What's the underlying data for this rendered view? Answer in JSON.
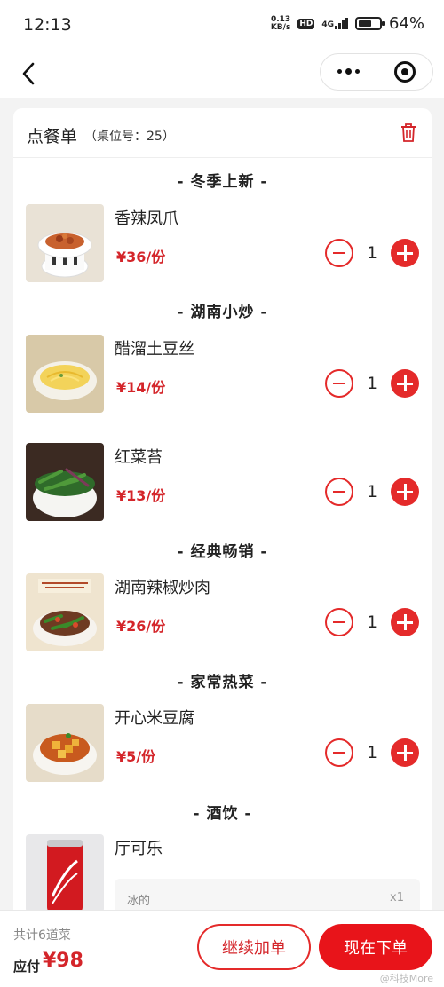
{
  "status": {
    "time": "12:13",
    "net_speed_top": "0.13",
    "net_speed_bottom": "KB/s",
    "hd": "HD",
    "network": "4G",
    "battery": "64%",
    "battery_level": 0.64
  },
  "header": {
    "title": "点餐单",
    "table_info": "（桌位号：25）"
  },
  "sections": [
    {
      "category": "- 冬季上新 -",
      "dishes": [
        {
          "name": "香辣凤爪",
          "price": "¥36/份",
          "qty": "1"
        }
      ]
    },
    {
      "category": "- 湖南小炒 -",
      "dishes": [
        {
          "name": "醋溜土豆丝",
          "price": "¥14/份",
          "qty": "1"
        },
        {
          "name": "红菜苔",
          "price": "¥13/份",
          "qty": "1"
        }
      ]
    },
    {
      "category": "- 经典畅销 -",
      "dishes": [
        {
          "name": "湖南辣椒炒肉",
          "price": "¥26/份",
          "qty": "1"
        }
      ]
    },
    {
      "category": "- 家常热菜 -",
      "dishes": [
        {
          "name": "开心米豆腐",
          "price": "¥5/份",
          "qty": "1"
        }
      ]
    },
    {
      "category": "- 酒饮 -",
      "dishes": [
        {
          "name": "厅可乐",
          "note": "冰的",
          "note_count": "x1"
        }
      ]
    }
  ],
  "footer": {
    "total_count": "共计6道菜",
    "pay_label": "应付",
    "pay_amount": "¥98",
    "continue_label": "继续加单",
    "order_label": "现在下单",
    "watermark": "@科技More"
  },
  "colors": {
    "accent": "#e42a2a",
    "price": "#d4252a"
  }
}
